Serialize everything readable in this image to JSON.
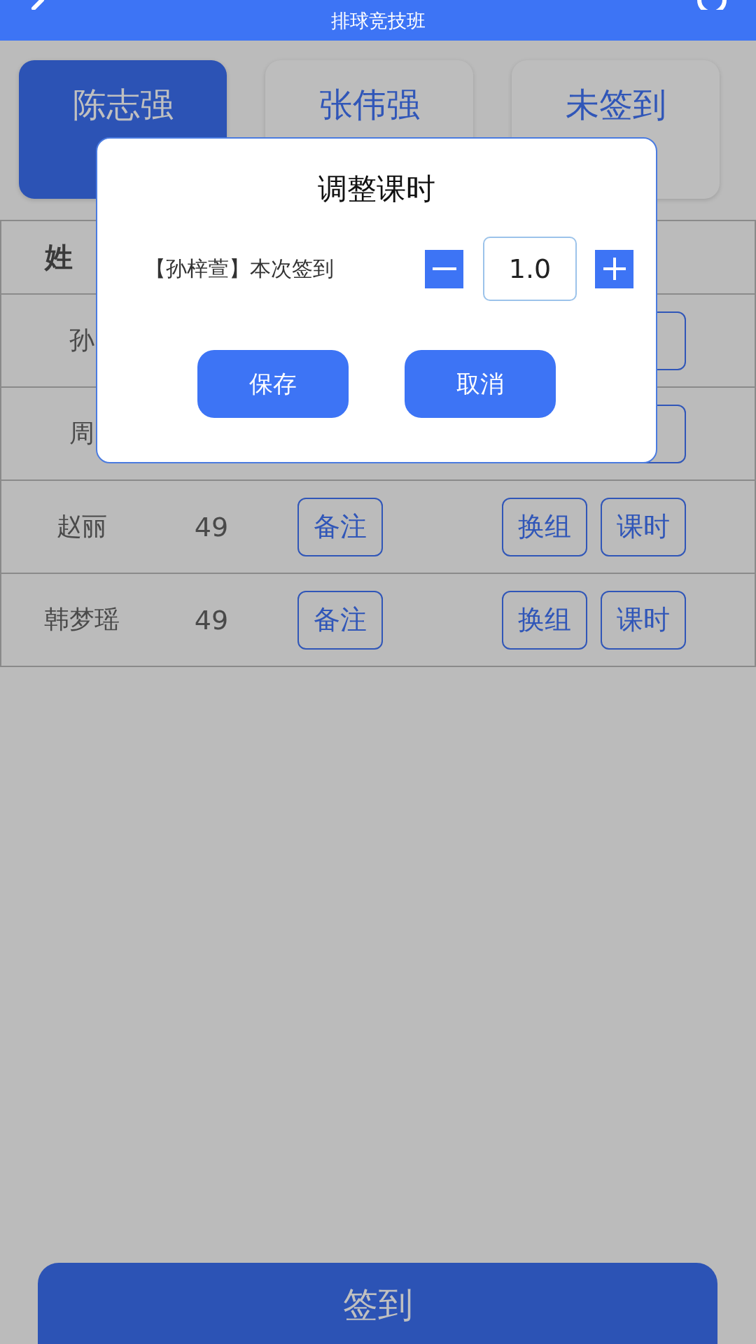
{
  "header": {
    "title": "排球竞技班"
  },
  "tabs": [
    {
      "label": "陈志强",
      "selected": true
    },
    {
      "label": "张伟强",
      "selected": false
    },
    {
      "label": "未签到",
      "selected": false
    }
  ],
  "table": {
    "header": "姓",
    "rows": [
      {
        "name": "孙",
        "covered": true
      },
      {
        "name": "周",
        "covered": true
      },
      {
        "name": "赵丽",
        "covered": false,
        "count": "49",
        "note": "备注",
        "actions": [
          "换组",
          "课时"
        ]
      },
      {
        "name": "韩梦瑶",
        "covered": false,
        "count": "49",
        "note": "备注",
        "actions": [
          "换组",
          "课时"
        ]
      }
    ]
  },
  "dialog": {
    "title": "调整课时",
    "label": "【孙梓萱】本次签到",
    "value": "1.0",
    "buttons": [
      "保存",
      "取消"
    ]
  },
  "sign_in_button": "签到"
}
